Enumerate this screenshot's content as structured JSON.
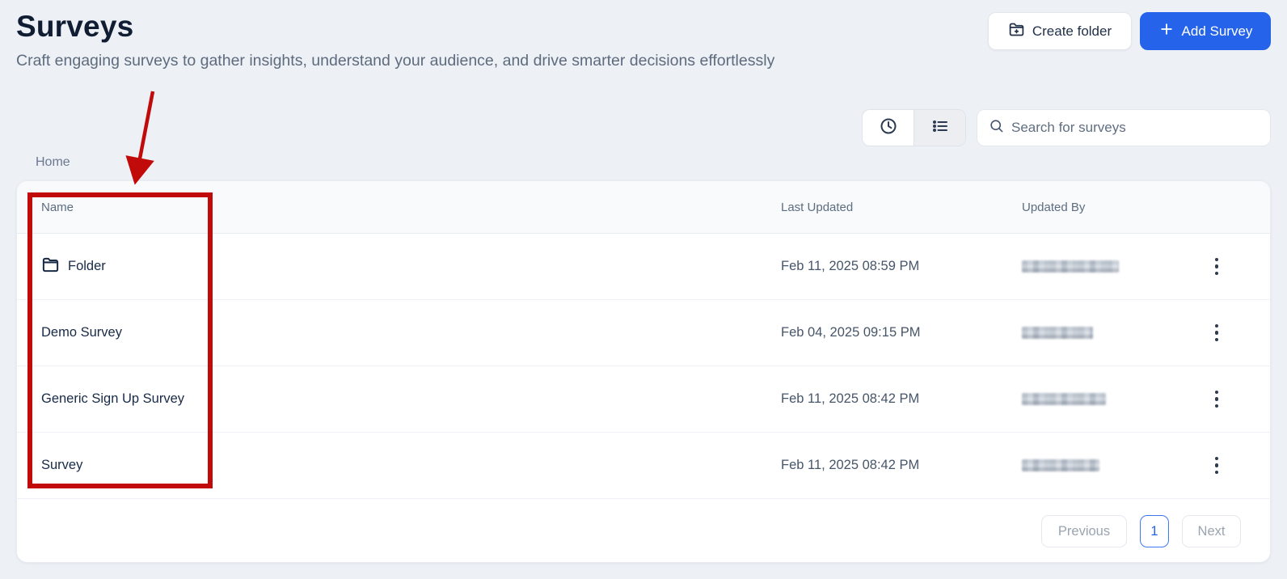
{
  "page": {
    "title": "Surveys",
    "subtitle": "Craft engaging surveys to gather insights, understand your audience, and drive smarter decisions effortlessly"
  },
  "header_actions": {
    "create_folder_label": "Create folder",
    "add_survey_label": "Add Survey"
  },
  "toolbar": {
    "search_placeholder": "Search for surveys",
    "view_toggle": {
      "active": "recent",
      "segments": [
        "clock-icon",
        "list-icon"
      ]
    }
  },
  "breadcrumb": {
    "home": "Home"
  },
  "table": {
    "columns": [
      {
        "key": "name",
        "label": "Name"
      },
      {
        "key": "last_updated",
        "label": "Last Updated"
      },
      {
        "key": "updated_by",
        "label": "Updated By"
      }
    ],
    "rows": [
      {
        "name": "Folder",
        "type": "folder",
        "icon": "folder-icon",
        "last_updated": "Feb 11, 2025 08:59 PM",
        "updated_by_redacted": true
      },
      {
        "name": "Demo Survey",
        "type": "survey",
        "last_updated": "Feb 04, 2025 09:15 PM",
        "updated_by_redacted": true
      },
      {
        "name": "Generic Sign Up Survey",
        "type": "survey",
        "last_updated": "Feb 11, 2025 08:42 PM",
        "updated_by_redacted": true
      },
      {
        "name": "Survey",
        "type": "survey",
        "last_updated": "Feb 11, 2025 08:42 PM",
        "updated_by_redacted": true
      }
    ],
    "row_action_icon": "kebab-menu-icon"
  },
  "pagination": {
    "previous_label": "Previous",
    "current_page": "1",
    "next_label": "Next"
  },
  "annotation": {
    "shape": "rectangle-with-arrow",
    "color": "#c10b0b",
    "highlights": "name-column"
  },
  "colors": {
    "accent_blue": "#2563eb",
    "page_background": "#edf1f6",
    "annotation_red": "#c10b0b"
  }
}
